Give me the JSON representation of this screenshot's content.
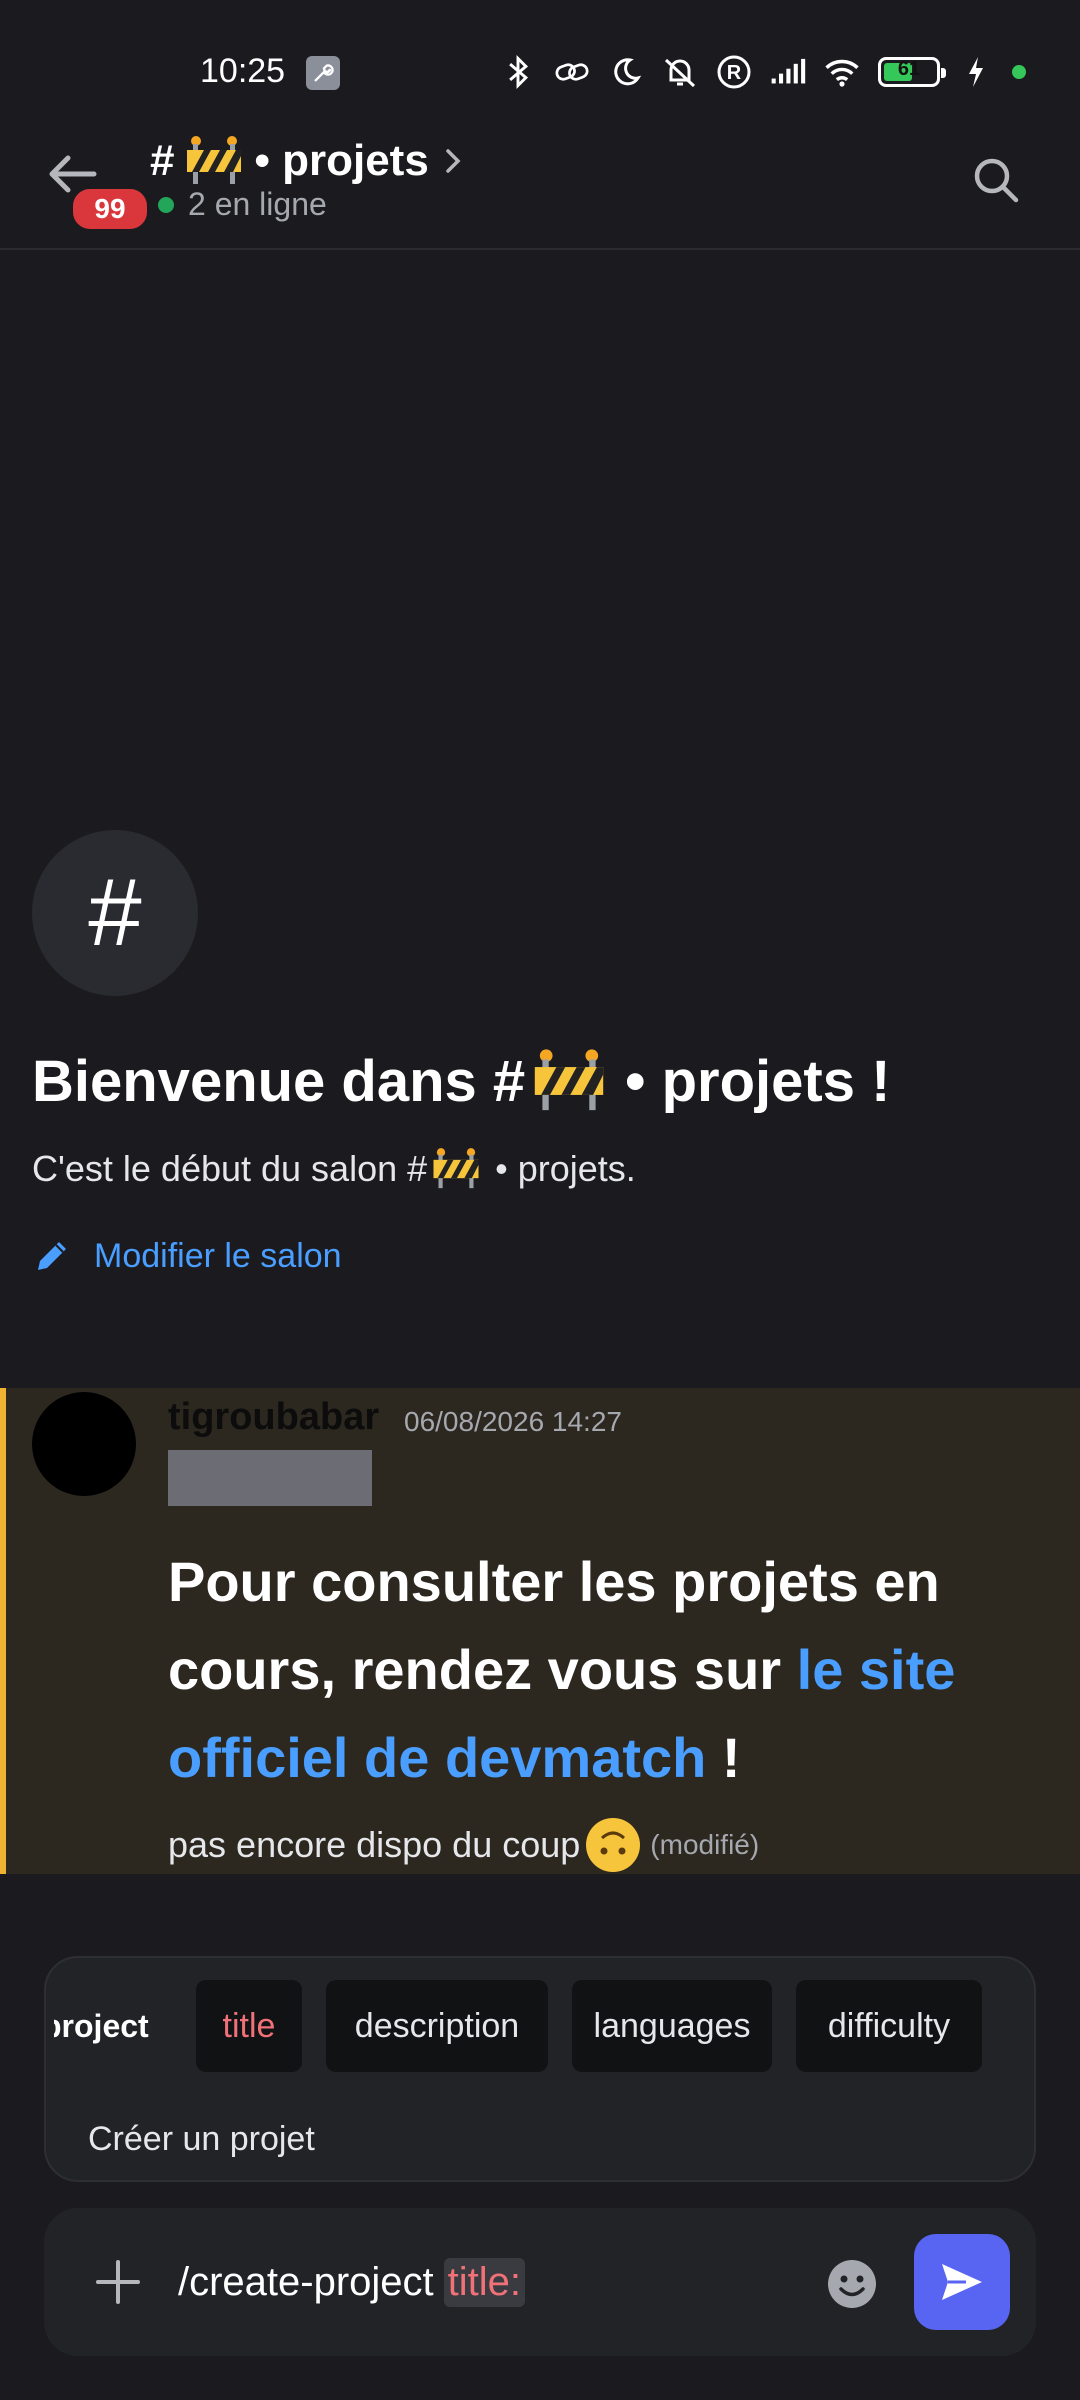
{
  "status_bar": {
    "time": "10:25",
    "battery_level": 61,
    "icons": [
      "wrench-icon",
      "bluetooth-icon",
      "link-icon",
      "moon-icon",
      "bell-off-icon",
      "registered-icon",
      "signal-icon",
      "wifi-icon",
      "battery-icon",
      "charging-icon"
    ]
  },
  "header": {
    "unread_count": "99",
    "channel_prefix": "#",
    "channel_name": "• projets",
    "online_text": "2 en ligne"
  },
  "welcome": {
    "hash": "#",
    "title_before": "Bienvenue dans #",
    "title_after": "• projets !",
    "subtitle_before": "C'est le début du salon #",
    "subtitle_after": "• projets.",
    "edit_label": "Modifier le salon"
  },
  "message": {
    "author": "tigroubabar",
    "timestamp": "06/08/2026 14:27",
    "heading_before": "Pour consulter les projets en cours, rendez vous sur ",
    "heading_link": "le site officiel de devmatch",
    "heading_after": " !",
    "line_text": "pas encore dispo du coup",
    "edited": "(modifié)"
  },
  "command_panel": {
    "label": "project",
    "options": [
      "title",
      "description",
      "languages",
      "difficulty"
    ],
    "description": "Créer un projet"
  },
  "input": {
    "command": "/create-project",
    "param": "title:"
  },
  "colors": {
    "accent": "#5865f2",
    "link": "#4a9eff",
    "highlight_bar": "#f0b232",
    "param": "#f07178",
    "badge": "#da373c"
  }
}
